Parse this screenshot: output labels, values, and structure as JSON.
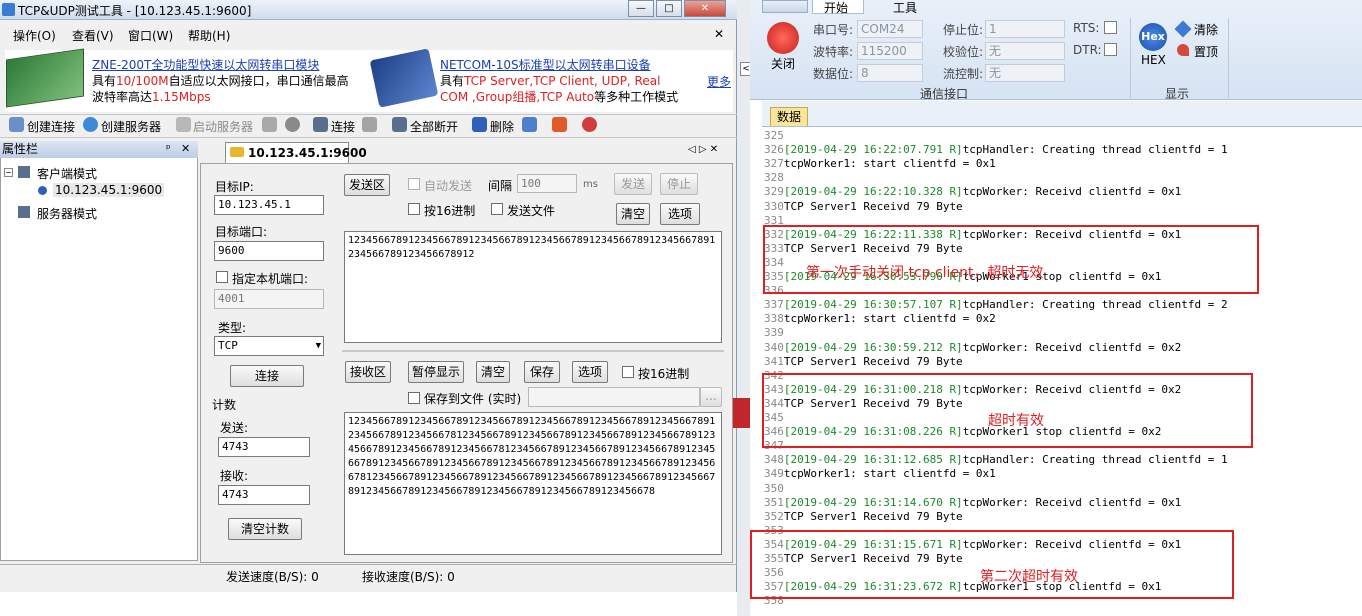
{
  "left_window": {
    "title": "TCP&UDP测试工具 - [10.123.45.1:9600]",
    "win_buttons": [
      "—",
      "□",
      "✕"
    ],
    "menu": [
      "操作(O)",
      "查看(V)",
      "窗口(W)",
      "帮助(H)"
    ],
    "menu_close": "✕",
    "ad": {
      "p1_title": "ZNE-200T全功能型快速以太网转串口模块",
      "p1_l2a": "具有",
      "p1_l2b": "10/100M",
      "p1_l2c": "自适应以太网接口，串口通信最高",
      "p1_l3a": "波特率高达",
      "p1_l3b": "1.15Mbps",
      "p2_title": "NETCOM-10S标准型以太网转串口设备",
      "p2_l2a": "具有",
      "p2_l2b": "TCP Server,TCP Client, UDP, Real",
      "p2_l3a": "COM ,Group组播,TCP Auto",
      "p2_l3b": "等多种工作模式",
      "more": "更多"
    },
    "toolbar": [
      "创建连接",
      "创建服务器",
      "启动服务器",
      "连接",
      "全部断开",
      "删除"
    ],
    "prop": {
      "header": "属性栏",
      "pin": "ᵖ",
      "close": "✕",
      "client_mode": "客户端模式",
      "conn": "10.123.45.1:9600",
      "server_mode": "服务器模式"
    },
    "tab": {
      "label": "10.123.45.1:9600",
      "nav": "◁ ▷ ✕"
    },
    "target_ip_label": "目标IP:",
    "target_ip": "10.123.45.1",
    "target_port_label": "目标端口:",
    "target_port": "9600",
    "local_port_label": "指定本机端口:",
    "local_port": "4001",
    "type_label": "类型:",
    "type": "TCP",
    "connect": "连接",
    "count_label": "计数",
    "send_label": "发送:",
    "send_count": "4743",
    "recv_label": "接收:",
    "recv_count": "4743",
    "clear_count": "清空计数",
    "send_area": "发送区",
    "auto_send": "自动发送",
    "interval": "间隔",
    "interval_val": "100",
    "ms": "ms",
    "send_btn": "发送",
    "stop_btn": "停止",
    "hex_send": "按16进制",
    "send_file": "发送文件",
    "clear": "清空",
    "options": "选项",
    "send_text": "1234566789123456678912345667891234566789123456678912345667891234566789123456678912",
    "recv_area": "接收区",
    "pause": "暂停显示",
    "clear2": "清空",
    "save": "保存",
    "options2": "选项",
    "hex_recv": "按16进制",
    "save_file": "保存到文件 (实时)",
    "browse": "...",
    "recv_text": "12345667891234566789123456678912345667891234566789123456678912345667891234566781234566789123456678912345667891234566789123456678912345667891234566781234566789123456678912345667891234566789123456678912345667891234566789123456678912345667891234566781234566789123456678912345667891234566789123456678912345667891234566789123456678912345667891234566789123456678",
    "status_send": "发送速度(B/S): 0",
    "status_recv": "接收速度(B/S): 0"
  },
  "right_window": {
    "tabs": [
      "开始",
      "工具"
    ],
    "close_btn": "关闭",
    "fields": [
      {
        "label": "串口号:",
        "value": "COM24"
      },
      {
        "label": "波特率:",
        "value": "115200"
      },
      {
        "label": "数据位:",
        "value": "8"
      },
      {
        "label": "停止位:",
        "value": "1"
      },
      {
        "label": "校验位:",
        "value": "无"
      },
      {
        "label": "流控制:",
        "value": "无"
      }
    ],
    "rts": "RTS:",
    "dtr": "DTR:",
    "group_comm": "通信接口",
    "hex": "HEX",
    "hex_icon": "Hex",
    "clear": "清除",
    "top": "置顶",
    "group_display": "显示",
    "data_tab": "数据",
    "lines": [
      {
        "n": "325",
        "a": "",
        "b": ""
      },
      {
        "n": "326",
        "a": "[2019-04-29 16:22:07.791 R]",
        "b": "tcpHandler: Creating thread clientfd = 1"
      },
      {
        "n": "327",
        "a": "",
        "b": "tcpWorker1: start clientfd = 0x1"
      },
      {
        "n": "328",
        "a": "",
        "b": ""
      },
      {
        "n": "329",
        "a": "[2019-04-29 16:22:10.328 R]",
        "b": "tcpWorker: Receivd clientfd = 0x1"
      },
      {
        "n": "330",
        "a": "",
        "b": "TCP Server1 Receivd 79 Byte"
      },
      {
        "n": "331",
        "a": "",
        "b": ""
      },
      {
        "n": "332",
        "a": "[2019-04-29 16:22:11.338 R]",
        "b": "tcpWorker: Receivd clientfd = 0x1"
      },
      {
        "n": "333",
        "a": "",
        "b": "TCP Server1 Receivd 79 Byte"
      },
      {
        "n": "334",
        "a": "",
        "b": ""
      },
      {
        "n": "335",
        "a": "[2019-04-29 16:30:53.790 R]",
        "b": "tcpWorker1 stop clientfd = 0x1"
      },
      {
        "n": "336",
        "a": "",
        "b": ""
      },
      {
        "n": "337",
        "a": "[2019-04-29 16:30:57.107 R]",
        "b": "tcpHandler: Creating thread clientfd = 2"
      },
      {
        "n": "338",
        "a": "",
        "b": "tcpWorker1: start clientfd = 0x2"
      },
      {
        "n": "339",
        "a": "",
        "b": ""
      },
      {
        "n": "340",
        "a": "[2019-04-29 16:30:59.212 R]",
        "b": "tcpWorker: Receivd clientfd = 0x2"
      },
      {
        "n": "341",
        "a": "",
        "b": "TCP Server1 Receivd 79 Byte"
      },
      {
        "n": "342",
        "a": "",
        "b": ""
      },
      {
        "n": "343",
        "a": "[2019-04-29 16:31:00.218 R]",
        "b": "tcpWorker: Receivd clientfd = 0x2"
      },
      {
        "n": "344",
        "a": "",
        "b": "TCP Server1 Receivd 79 Byte"
      },
      {
        "n": "345",
        "a": "",
        "b": ""
      },
      {
        "n": "346",
        "a": "[2019-04-29 16:31:08.226 R]",
        "b": "tcpWorker1 stop clientfd = 0x2"
      },
      {
        "n": "347",
        "a": "",
        "b": ""
      },
      {
        "n": "348",
        "a": "[2019-04-29 16:31:12.685 R]",
        "b": "tcpHandler: Creating thread clientfd = 1"
      },
      {
        "n": "349",
        "a": "",
        "b": "tcpWorker1: start clientfd = 0x1"
      },
      {
        "n": "350",
        "a": "",
        "b": ""
      },
      {
        "n": "351",
        "a": "[2019-04-29 16:31:14.670 R]",
        "b": "tcpWorker: Receivd clientfd = 0x1"
      },
      {
        "n": "352",
        "a": "",
        "b": "TCP Server1 Receivd 79 Byte"
      },
      {
        "n": "353",
        "a": "",
        "b": ""
      },
      {
        "n": "354",
        "a": "[2019-04-29 16:31:15.671 R]",
        "b": "tcpWorker: Receivd clientfd = 0x1"
      },
      {
        "n": "355",
        "a": "",
        "b": "TCP Server1 Receivd 79 Byte"
      },
      {
        "n": "356",
        "a": "",
        "b": ""
      },
      {
        "n": "357",
        "a": "[2019-04-29 16:31:23.672 R]",
        "b": "tcpWorker1 stop clientfd = 0x1"
      },
      {
        "n": "358",
        "a": "",
        "b": ""
      }
    ],
    "annotations": [
      "第一次手动关闭 tcp client，超时无效",
      "超时有效",
      "第二次超时有效"
    ]
  },
  "colors": {
    "accent_red": "#e02020",
    "green_ts": "#1c8a2a",
    "ad_blue": "#1a3fb8"
  }
}
